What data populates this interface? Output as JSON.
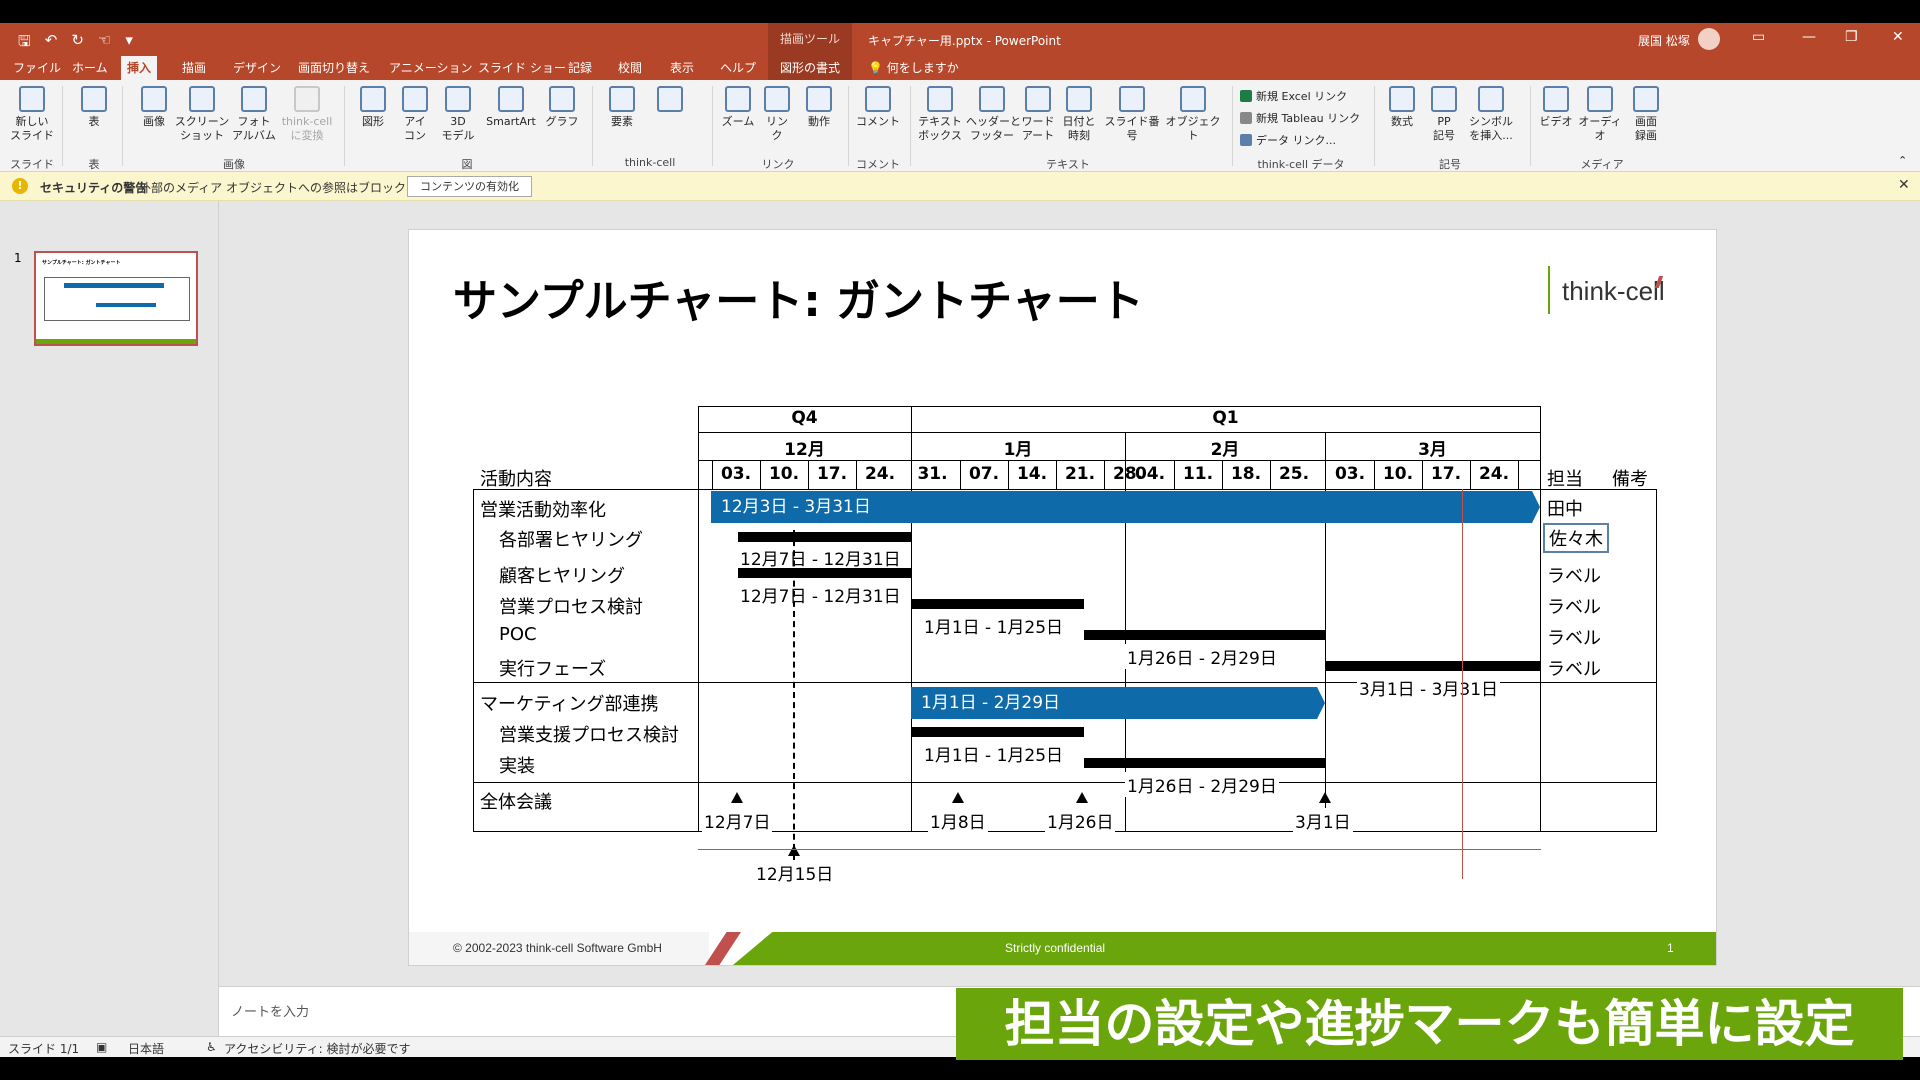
{
  "titlebar": {
    "context_tools": "描画ツール",
    "filename": "キャプチャー用.pptx",
    "app": "PowerPoint",
    "user": "展国 松塚"
  },
  "tabs": [
    "ファイル",
    "ホーム",
    "挿入",
    "描画",
    "デザイン",
    "画面切り替え",
    "アニメーション",
    "スライド ショー",
    "記録",
    "校閲",
    "表示",
    "ヘルプ",
    "図形の書式"
  ],
  "tell_me": "何をしますか",
  "ribbon": {
    "new_slide": "新しい\nスライド",
    "table": "表",
    "image": "画像",
    "screenshot": "スクリーン\nショット",
    "photo_album": "フォト\nアルバム",
    "thinkcell_convert": "think-cell\nに変換",
    "shapes": "図形",
    "icons": "アイ\nコン",
    "models3d": "3D\nモデル",
    "smartart": "SmartArt",
    "graph": "グラフ",
    "elements": "要素",
    "zoom": "ズーム",
    "link": "リン\nク",
    "action": "動作",
    "comment": "コメント",
    "textbox": "テキスト\nボックス",
    "header_footer": "ヘッダーと\nフッター",
    "wordart": "ワード\nアート",
    "datetime": "日付と\n時刻",
    "slide_number": "スライド番号",
    "object": "オブジェクト",
    "new_excel_link": "新規 Excel リンク",
    "new_tableau_link": "新規 Tableau リンク",
    "data_link": "データ リンク...",
    "equation": "数式",
    "pp_symbol": "PP\n記号",
    "symbol_insert": "シンボル\nを挿入...",
    "video": "ビデオ",
    "audio": "オーディオ",
    "screen_record": "画面\n録画",
    "groups": {
      "slide": "スライド",
      "table": "表",
      "images": "画像",
      "figures": "図",
      "thinkcell": "think-cell",
      "link": "リンク",
      "comment": "コメント",
      "text": "テキスト",
      "thinkcell_data": "think-cell データ",
      "symbols": "記号",
      "media": "メディア"
    }
  },
  "security": {
    "title": "セキュリティの警告",
    "message": "外部のメディア オブジェクトへの参照はブロックされました",
    "button": "コンテンツの有効化"
  },
  "thumbnail_number": "1",
  "slide": {
    "title": "サンプルチャート: ガントチャート",
    "logo": "think-cell",
    "footer_copyright": "© 2002-2023 think-cell Software GmbH",
    "footer_confidential": "Strictly confidential",
    "footer_page": "1"
  },
  "gantt": {
    "quarters": [
      "Q4",
      "Q1"
    ],
    "months": [
      "12月",
      "1月",
      "2月",
      "3月"
    ],
    "weeks": [
      "03.",
      "10.",
      "17.",
      "24.",
      "31.",
      "07.",
      "14.",
      "21.",
      "28.",
      "04.",
      "11.",
      "18.",
      "25.",
      "03.",
      "10.",
      "17.",
      "24."
    ],
    "col_activity": "活動内容",
    "col_owner": "担当",
    "col_notes": "備考",
    "rows": [
      {
        "name": "営業活動効率化",
        "owner": "田中",
        "bar": "12月3日 - 3月31日"
      },
      {
        "name": "各部署ヒヤリング",
        "owner": "佐々木",
        "bar": "12月7日 - 12月31日"
      },
      {
        "name": "顧客ヒヤリング",
        "owner": "ラベル",
        "bar": "12月7日 - 12月31日"
      },
      {
        "name": "営業プロセス検討",
        "owner": "ラベル",
        "bar": "1月1日 - 1月25日"
      },
      {
        "name": "POC",
        "owner": "ラベル",
        "bar": "1月26日 - 2月29日"
      },
      {
        "name": "実行フェーズ",
        "owner": "ラベル",
        "bar": "3月1日 - 3月31日"
      },
      {
        "name": "マーケティング部連携",
        "owner": "",
        "bar": "1月1日 - 2月29日"
      },
      {
        "name": "営業支援プロセス検討",
        "owner": "",
        "bar": "1月1日 - 1月25日"
      },
      {
        "name": "実装",
        "owner": "",
        "bar": "1月26日 - 2月29日"
      },
      {
        "name": "全体会議",
        "owner": "",
        "bar": ""
      }
    ],
    "milestones": [
      "12月7日",
      "1月8日",
      "1月26日",
      "3月1日"
    ],
    "today": "12月15日"
  },
  "notes_placeholder": "ノートを入力",
  "status": {
    "slide": "スライド 1/1",
    "language": "日本語",
    "accessibility": "アクセシビリティ: 検討が必要です"
  },
  "caption": "担当の設定や進捗マークも簡単に設定",
  "colors": {
    "accent": "#b7472a",
    "bar_blue": "#0e6aa8",
    "footer_green": "#6aa50c"
  }
}
